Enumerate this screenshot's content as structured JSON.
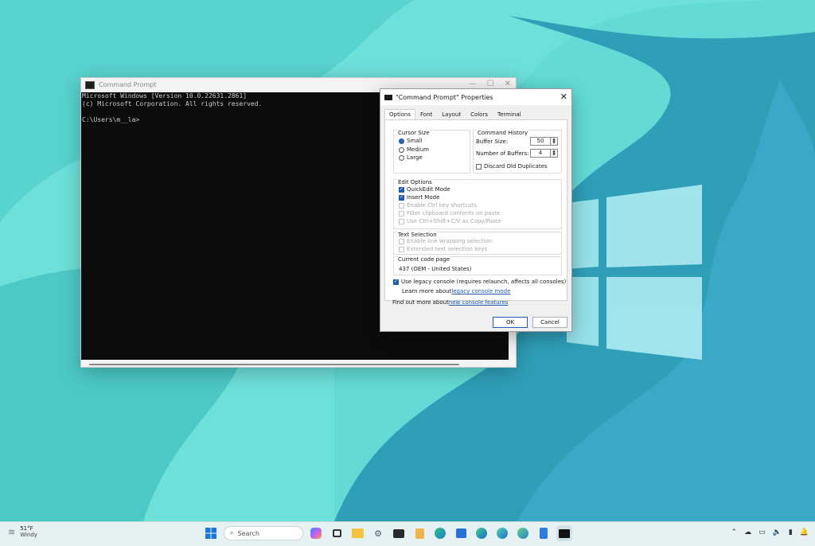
{
  "console": {
    "title": "Command Prompt",
    "lines": [
      "Microsoft Windows [Version 10.0.22631.2861]",
      "(c) Microsoft Corporation. All rights reserved.",
      "",
      "C:\\Users\\m__la>"
    ]
  },
  "dialog": {
    "title": "\"Command Prompt\" Properties",
    "tabs": [
      "Options",
      "Font",
      "Layout",
      "Colors",
      "Terminal"
    ],
    "active_tab": "Options",
    "cursor_size": {
      "title": "Cursor Size",
      "options": [
        "Small",
        "Medium",
        "Large"
      ],
      "selected": "Small"
    },
    "command_history": {
      "title": "Command History",
      "buffer_size_label": "Buffer Size:",
      "buffer_size_value": "50",
      "buffers_label": "Number of Buffers:",
      "buffers_value": "4",
      "discard_label": "Discard Old Duplicates",
      "discard_checked": false
    },
    "edit_options": {
      "title": "Edit Options",
      "items": [
        {
          "label": "QuickEdit Mode",
          "checked": true,
          "enabled": true
        },
        {
          "label": "Insert Mode",
          "checked": true,
          "enabled": true
        },
        {
          "label": "Enable Ctrl key shortcuts",
          "checked": false,
          "enabled": false
        },
        {
          "label": "Filter clipboard contents on paste",
          "checked": false,
          "enabled": false
        },
        {
          "label": "Use Ctrl+Shift+C/V as Copy/Paste",
          "checked": false,
          "enabled": false
        }
      ]
    },
    "text_selection": {
      "title": "Text Selection",
      "items": [
        {
          "label": "Enable line wrapping selection",
          "checked": false,
          "enabled": false
        },
        {
          "label": "Extended text selection keys",
          "checked": false,
          "enabled": false
        }
      ]
    },
    "code_page": {
      "title": "Current code page",
      "value": "437   (OEM - United States)"
    },
    "legacy": {
      "label": "Use legacy console (requires relaunch, affects all consoles)",
      "checked": true,
      "learn_prefix": "Learn more about ",
      "learn_link": "legacy console mode"
    },
    "features": {
      "prefix": "Find out more about ",
      "link": "new console features"
    },
    "ok_label": "OK",
    "cancel_label": "Cancel"
  },
  "taskbar": {
    "weather_temp": "51°F",
    "weather_text": "Windy",
    "search_placeholder": "Search"
  },
  "colors": {
    "accent": "#1f5bb0",
    "desktop": "#4fd6d0"
  }
}
